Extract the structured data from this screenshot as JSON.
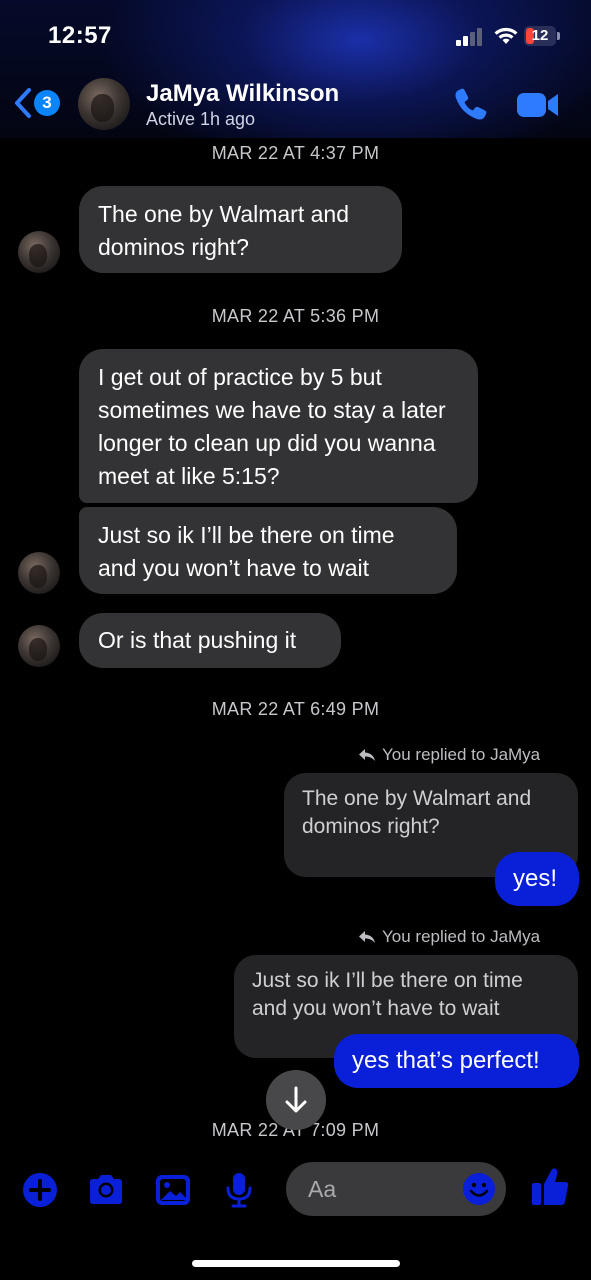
{
  "status_bar": {
    "time": "12:57",
    "battery": "12"
  },
  "header": {
    "back_badge": "3",
    "contact_name": "JaMya Wilkinson",
    "contact_status": "Active 1h ago",
    "icons": {
      "back": "chevron-left-icon",
      "call": "phone-icon",
      "video": "video-camera-icon"
    }
  },
  "chat": {
    "stamps": [
      "MAR 22 AT 4:37 PM",
      "MAR 22 AT 5:36 PM",
      "MAR 22 AT 6:49 PM",
      "MAR 22 AT 7:09 PM"
    ],
    "incoming": [
      "The one by Walmart and dominos right?",
      "I get out of practice by 5 but sometimes we have to stay a later longer to clean up did you wanna meet at like 5:15?",
      "Just so ik I’ll be there on time and you won’t have to wait",
      "Or is that pushing it"
    ],
    "replies": [
      {
        "note": "You replied to JaMya",
        "quoted": "The one by Walmart and dominos right?",
        "message": "yes!"
      },
      {
        "note": "You replied to JaMya",
        "quoted": "Just so ik I’ll be there on time and you won’t have to wait",
        "message": "yes that’s perfect!"
      }
    ]
  },
  "composer": {
    "placeholder": "Aa",
    "icons": [
      "plus-icon",
      "camera-icon",
      "photo-icon",
      "microphone-icon",
      "emoji-icon",
      "thumbs-up-icon"
    ]
  },
  "colors": {
    "accent": "#0a1fd8",
    "incoming_bubble": "#333336",
    "background": "#000000"
  }
}
